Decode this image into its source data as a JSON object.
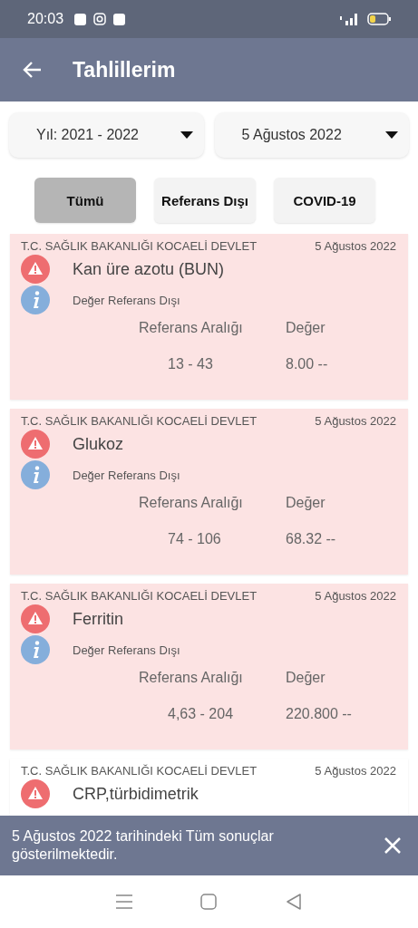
{
  "status_bar": {
    "time": "20:03"
  },
  "app_bar": {
    "title": "Tahlillerim"
  },
  "filters": [
    {
      "value": "Yıl: 2021 - 2022"
    },
    {
      "value": "5 Ağustos 2022"
    }
  ],
  "tabs": [
    {
      "label": "Tümü",
      "selected": true
    },
    {
      "label": "Referans Dışı",
      "selected": false
    },
    {
      "label": "COVID-19",
      "selected": false
    }
  ],
  "results": [
    {
      "source": "T.C. SAĞLIK BAKANLIĞI KOCAELİ DEVLET",
      "date": "5 Ağustos 2022",
      "name": "Kan üre azotu (BUN)",
      "highlighted": true,
      "note": "Değer Referans Dışı",
      "range_label": "Referans Aralığı",
      "value_label": "Değer",
      "range": "13 - 43",
      "value": "8.00 --"
    },
    {
      "source": "T.C. SAĞLIK BAKANLIĞI KOCAELİ DEVLET",
      "date": "5 Ağustos 2022",
      "name": "Glukoz",
      "highlighted": true,
      "note": "Değer Referans Dışı",
      "range_label": "Referans Aralığı",
      "value_label": "Değer",
      "range": "74 - 106",
      "value": "68.32 --"
    },
    {
      "source": "T.C. SAĞLIK BAKANLIĞI KOCAELİ DEVLET",
      "date": "5 Ağustos 2022",
      "name": "Ferritin",
      "highlighted": true,
      "note": "Değer Referans Dışı",
      "range_label": "Referans Aralığı",
      "value_label": "Değer",
      "range": "4,63 - 204",
      "value": "220.800 --"
    },
    {
      "source": "T.C. SAĞLIK BAKANLIĞI KOCAELİ DEVLET",
      "date": "5 Ağustos 2022",
      "name": "CRP,türbidimetrik",
      "highlighted": false
    }
  ],
  "snackbar": {
    "message": "5 Ağustos 2022 tarihindeki Tüm sonuçlar gösterilmektedir."
  }
}
